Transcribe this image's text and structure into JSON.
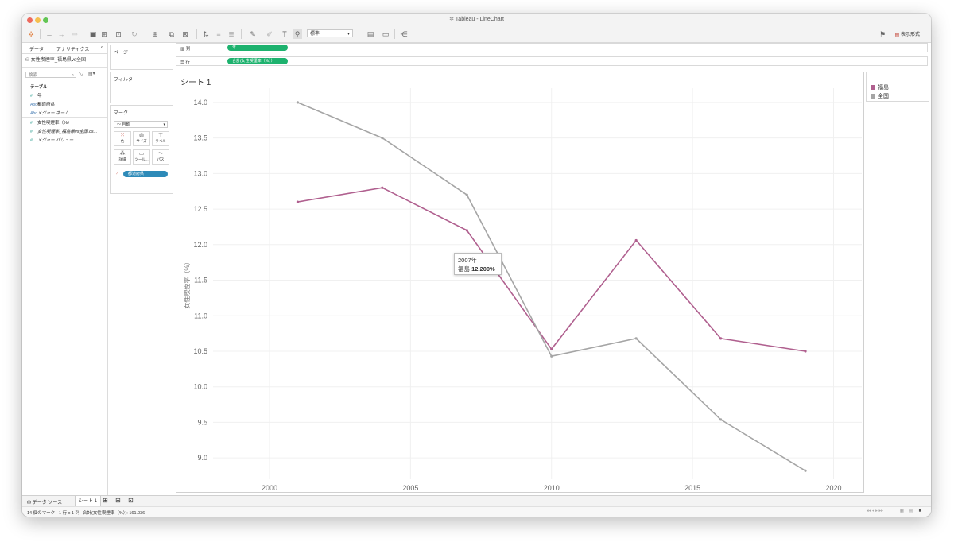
{
  "window": {
    "title": "Tableau - LineChart"
  },
  "left_pane": {
    "tabs": [
      "データ",
      "アナリティクス"
    ],
    "datasource": "女性喫煙率_福島県vs全国",
    "search_placeholder": "検索",
    "table_heading": "テーブル",
    "fields": [
      {
        "type": "#",
        "name": "年"
      },
      {
        "type": "Abc",
        "name": "都道府県"
      },
      {
        "type": "Abc",
        "name": "メジャー ネーム"
      },
      {
        "type": "#",
        "name": "女性喫煙率（%）"
      },
      {
        "type": "#",
        "name": "女性喫煙率_福島県vs全国.cs..."
      },
      {
        "type": "#",
        "name": "メジャー バリュー"
      }
    ]
  },
  "cards": {
    "pages": "ページ",
    "filters": "フィルター",
    "marks": "マーク",
    "mark_type": "自動",
    "mark_buttons": [
      "色",
      "サイズ",
      "ラベル",
      "詳細",
      "ツール...",
      "パス"
    ],
    "color_pill": "都道府県"
  },
  "shelves": {
    "columns_label": "列",
    "columns_pill": "年",
    "rows_label": "行",
    "rows_pill": "合計(女性喫煙率（%））"
  },
  "toolbar": {
    "standard": "標準",
    "show_me": "表示形式"
  },
  "sheet": {
    "title": "シート 1"
  },
  "legend": [
    {
      "name": "福島",
      "color": "#b0608f"
    },
    {
      "name": "全国",
      "color": "#a5a5a5"
    }
  ],
  "tooltip": {
    "line1": "2007年",
    "label": "福島",
    "value": "12.200%"
  },
  "chart_data": {
    "type": "line",
    "title": "",
    "xlabel": "",
    "ylabel": "女性喫煙率（%）",
    "xlim": [
      1998,
      2021
    ],
    "ylim": [
      8.7,
      14.2
    ],
    "x_ticks": [
      2000,
      2005,
      2010,
      2015,
      2020
    ],
    "y_ticks": [
      9.0,
      9.5,
      10.0,
      10.5,
      11.0,
      11.5,
      12.0,
      12.5,
      13.0,
      13.5,
      14.0
    ],
    "grid": true,
    "legend_position": "right",
    "series": [
      {
        "name": "福島",
        "color": "#b0608f",
        "x": [
          2001,
          2004,
          2007,
          2010,
          2013,
          2016,
          2019
        ],
        "y": [
          12.6,
          12.8,
          12.2,
          10.53,
          12.06,
          10.68,
          10.5
        ]
      },
      {
        "name": "全国",
        "color": "#a5a5a5",
        "x": [
          2001,
          2004,
          2007,
          2010,
          2013,
          2016,
          2019
        ],
        "y": [
          14.0,
          13.5,
          12.7,
          10.43,
          10.68,
          9.54,
          8.82
        ]
      }
    ]
  },
  "bottom": {
    "datasource_tab": "データ ソース",
    "sheet_tab": "シート 1"
  },
  "status": {
    "marks": "14 個のマーク",
    "grid": "1 行 x 1 列",
    "sum": "合計(女性喫煙率（%）): 161.036"
  }
}
